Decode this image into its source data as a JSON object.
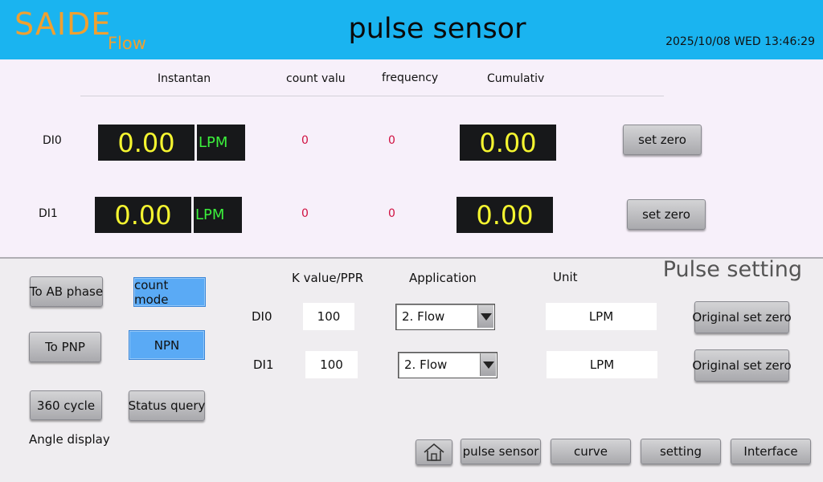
{
  "header": {
    "logo_main": "SAIDE",
    "logo_sub": "Flow",
    "title": "pulse sensor",
    "datetime": "2025/10/08 WED 13:46:29"
  },
  "columns": {
    "instant": "Instantan",
    "count": "count valu",
    "frequency": "frequency",
    "cumulative": "Cumulativ"
  },
  "channels": [
    {
      "name": "DI0",
      "instant": "0.00",
      "unit": "LPM",
      "count": "0",
      "frequency": "0",
      "cumulative": "0.00",
      "zero_label": "set zero"
    },
    {
      "name": "DI1",
      "instant": "0.00",
      "unit": "LPM",
      "count": "0",
      "frequency": "0",
      "cumulative": "0.00",
      "zero_label": "set zero"
    }
  ],
  "controls": {
    "ab_phase": "To AB phase",
    "count_mode": "count mode",
    "pnp": "To PNP",
    "npn": "NPN",
    "cycle": "360 cycle",
    "status_query": "Status query",
    "angle_display": "Angle display"
  },
  "settings": {
    "section_title": "Pulse setting",
    "k_header": "K value/PPR",
    "app_header": "Application",
    "unit_header": "Unit",
    "rows": [
      {
        "name": "DI0",
        "k": "100",
        "application": "2. Flow",
        "unit": "LPM",
        "reset_label": "Original set zero"
      },
      {
        "name": "DI1",
        "k": "100",
        "application": "2. Flow",
        "unit": "LPM",
        "reset_label": "Original set zero"
      }
    ]
  },
  "nav": {
    "pulse_sensor": "pulse sensor",
    "curve": "curve",
    "setting": "setting",
    "interface": "Interface"
  },
  "colors": {
    "header_bg": "#1ab4f0",
    "logo": "#f0a030",
    "display_value": "#f5f530",
    "display_unit": "#3cf03c",
    "count_value": "#d01040",
    "active_button": "#5aaaf5"
  }
}
